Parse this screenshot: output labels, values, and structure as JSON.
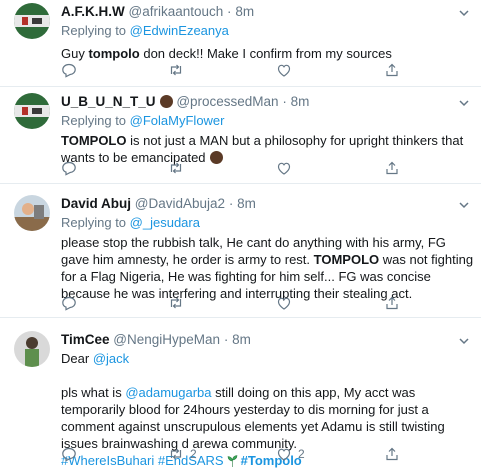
{
  "tweets": [
    {
      "name": "A.F.K.H.W",
      "handle": "@afrikaantouch",
      "time": "8m",
      "reply_prefix": "Replying to",
      "reply_to": "@EdwinEzeanya",
      "text_1": "Guy ",
      "text_bold": "tompolo",
      "text_2": " don deck!! Make I confirm from my sources",
      "reply_count": "",
      "retweet_count": "",
      "like_count": ""
    },
    {
      "name": "U_B_U_N_T_U",
      "handle": "@processedMan",
      "time": "8m",
      "reply_prefix": "Replying to",
      "reply_to": "@FolaMyFlower",
      "text_bold": "TOMPOLO",
      "text_2": " is not just a MAN but a philosophy for upright thinkers that wants to be emancipated",
      "reply_count": "",
      "retweet_count": "",
      "like_count": ""
    },
    {
      "name": "David Abuj",
      "handle": "@DavidAbuja2",
      "time": "8m",
      "reply_prefix": "Replying to",
      "reply_to": "@_jesudara",
      "text_1": "please stop the rubbish talk, He cant do anything with his army, FG gave him amnesty, he order is army to rest. ",
      "text_bold": "TOMPOLO",
      "text_2": " was not fighting for a Flag Nigeria, He was fighting for him self... FG was concise because he was interfering and interrupting their stealing act.",
      "reply_count": "",
      "retweet_count": "",
      "like_count": ""
    },
    {
      "name": "TimCee",
      "handle": "@NengiHypeMan",
      "time": "8m",
      "dear": "Dear",
      "dear_link": "@jack",
      "text_1": "pls what is ",
      "text_link": "@adamugarba",
      "text_2": " still doing on this app, My acct was temporarily blood for 24hours yesterday to dis morning for just a comment against unscrupulous elements yet Adamu is still twisting issues brainwashing d arewa community.",
      "hashtag_1": "#WhereIsBuhari",
      "hashtag_2": "#EndSARS",
      "hashtag_3": "#Tompolo",
      "reply_count": "",
      "retweet_count": "2",
      "like_count": "2"
    }
  ],
  "colors": {
    "link": "#1b95e0",
    "muted": "#657786",
    "divider": "#e6ecf0"
  },
  "icons": [
    "reply-icon",
    "retweet-icon",
    "like-icon",
    "share-icon",
    "chevron-down-icon"
  ]
}
